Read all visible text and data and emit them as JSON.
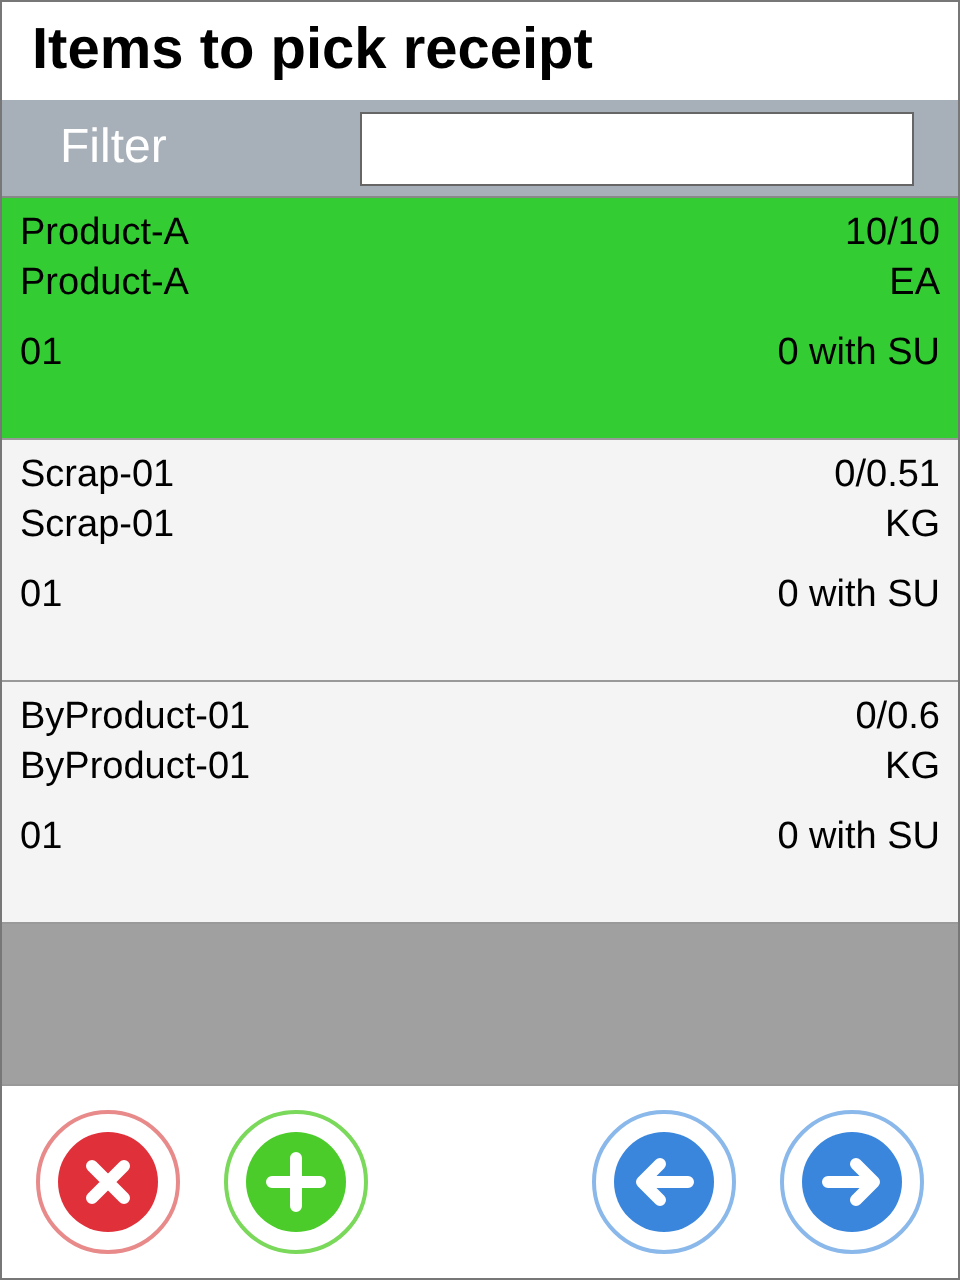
{
  "window": {
    "title": "Items to pick receipt"
  },
  "filter": {
    "label": "Filter"
  },
  "items": [
    {
      "name": "Product-A",
      "description": "Product-A",
      "quantity": "10/10",
      "unit": "EA",
      "code": "01",
      "su": "0 with SU",
      "selected": true
    },
    {
      "name": "Scrap-01",
      "description": "Scrap-01",
      "quantity": "0/0.51",
      "unit": "KG",
      "code": "01",
      "su": "0 with SU",
      "selected": false
    },
    {
      "name": "ByProduct-01",
      "description": "ByProduct-01",
      "quantity": "0/0.6",
      "unit": "KG",
      "code": "01",
      "su": "0 with SU",
      "selected": false
    }
  ],
  "buttons": [
    {
      "kind": "cancel"
    },
    {
      "kind": "add"
    },
    {
      "kind": "back"
    },
    {
      "kind": "next"
    }
  ]
}
